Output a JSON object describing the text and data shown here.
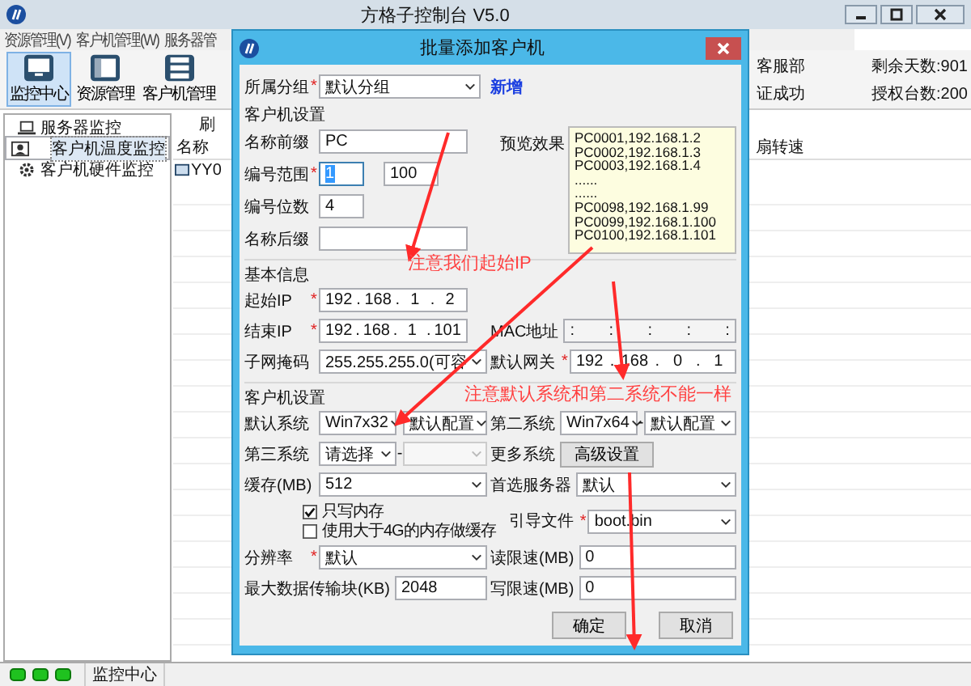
{
  "window": {
    "title": "方格子控制台 V5.0"
  },
  "menu": [
    "资源管理(V)",
    "客户机管理(W)",
    "服务器管"
  ],
  "toolbar": [
    {
      "label": "监控中心",
      "selected": true
    },
    {
      "label": "资源管理",
      "selected": false
    },
    {
      "label": "客户机管理",
      "selected": false
    }
  ],
  "info": {
    "line_1": "客服部",
    "line_2": "证成功",
    "days": "剩余天数:901",
    "licenses": "授权台数:200"
  },
  "tree": [
    {
      "label": "服务器监控",
      "selected": false
    },
    {
      "label": "客户机温度监控",
      "selected": true
    },
    {
      "label": "客户机硬件监控",
      "selected": false
    }
  ],
  "panel": {
    "refresh": "刷",
    "columns": [
      "名称",
      "扇转速"
    ],
    "rows": [
      "YY0"
    ]
  },
  "dialog": {
    "title": "批量添加客户机",
    "joiner": "-",
    "ip_separator": ".",
    "group": {
      "label": "所属分组",
      "required": "*",
      "value": "默认分组",
      "link": "新增"
    },
    "client_section": "客户机设置",
    "name_prefix": {
      "label": "名称前缀",
      "value": "PC"
    },
    "number_range": {
      "label": "编号范围",
      "required": "*",
      "from": "1",
      "to": "100"
    },
    "number_digits": {
      "label": "编号位数",
      "value": "4"
    },
    "name_suffix": {
      "label": "名称后缀"
    },
    "preview": {
      "label": "预览效果",
      "lines": [
        "PC0001,192.168.1.2",
        "PC0002,192.168.1.3",
        "PC0003,192.168.1.4",
        "......",
        "......",
        "PC0098,192.168.1.99",
        "PC0099,192.168.1.100",
        "PC0100,192.168.1.101"
      ]
    },
    "basic_section": "基本信息",
    "start_ip": {
      "label": "起始IP",
      "required": "*",
      "octets": [
        "192",
        "168",
        "1",
        "2"
      ]
    },
    "end_ip": {
      "label": "结束IP",
      "required": "*",
      "octets": [
        "192",
        "168",
        "1",
        "101"
      ]
    },
    "mac": {
      "label": "MAC地址",
      "separators": [
        ":",
        ":",
        ":",
        ":",
        ":"
      ]
    },
    "subnet": {
      "label": "子网掩码",
      "value": "255.255.255.0(可容"
    },
    "gateway": {
      "label": "默认网关",
      "required": "*",
      "octets": [
        "192",
        "168",
        "0",
        "1"
      ]
    },
    "system_section": "客户机设置",
    "default_system": {
      "label": "默认系统",
      "os": "Win7x32",
      "config": "默认配置"
    },
    "second_system": {
      "label": "第二系统",
      "os": "Win7x64",
      "config": "默认配置"
    },
    "third_system": {
      "label": "第三系统",
      "os": "请选择",
      "config_disabled": true
    },
    "more_systems": {
      "label": "更多系统",
      "button": "高级设置"
    },
    "cache": {
      "label": "缓存(MB)",
      "value": "512"
    },
    "preferred_server": {
      "label": "首选服务器",
      "value": "默认"
    },
    "checkboxes": [
      {
        "label": "只写内存",
        "checked": true
      },
      {
        "label": "使用大于4G的内存做缓存",
        "checked": false
      }
    ],
    "boot_file": {
      "label": "引导文件",
      "required": "*",
      "value": "boot.bin"
    },
    "resolution": {
      "label": "分辨率",
      "required": "*",
      "value": "默认"
    },
    "read_limit": {
      "label": "读限速(MB)",
      "value": "0"
    },
    "max_block": {
      "label": "最大数据传输块(KB)",
      "value": "2048"
    },
    "write_limit": {
      "label": "写限速(MB)",
      "value": "0"
    },
    "buttons": [
      "确定",
      "取消"
    ]
  },
  "annotations": [
    {
      "text": "注意我们起始IP"
    },
    {
      "text": "注意默认系统和第二系统不能一样"
    }
  ],
  "status_bar": {
    "text": "监控中心"
  }
}
